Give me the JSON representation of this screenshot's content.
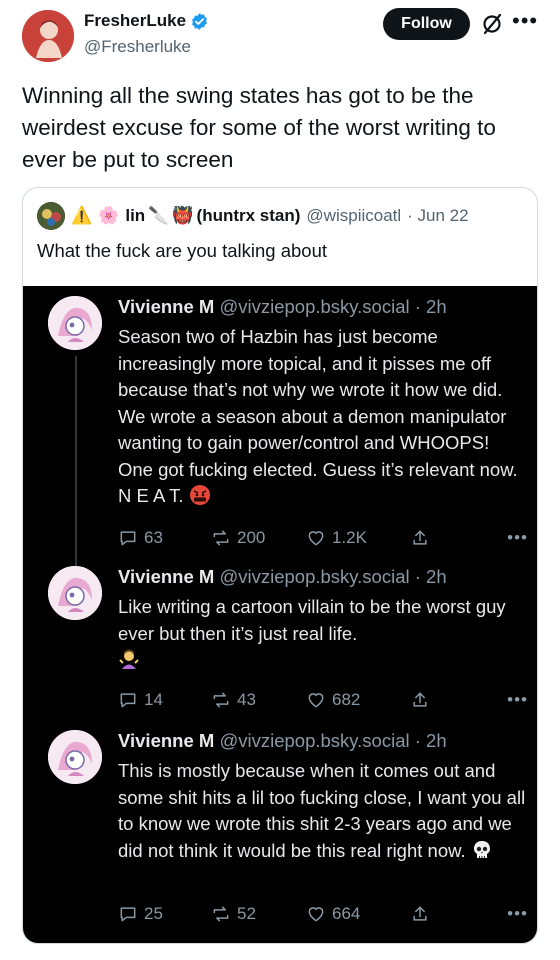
{
  "author": {
    "display_name": "FresherLuke",
    "handle": "@Fresherluke",
    "follow_label": "Follow"
  },
  "tweet": {
    "text": "Winning all the swing states has got to be the weirdest excuse for some of the worst writing to ever be put to screen"
  },
  "quoted": {
    "name": "lin",
    "name_suffix": "(huntrx stan)",
    "handle": "@wispiicoatl",
    "time": "· Jun 22",
    "text": "What the fuck are you talking about"
  },
  "screenshot_posts": [
    {
      "name": "Vivienne M",
      "handle": "@vivziepop.bsky.social · 2h",
      "body": "Season two of Hazbin has just become increasingly more topical, and it pisses me off because that’s not why we wrote it how we did. We wrote a season about a demon manipulator wanting to gain power/control and WHOOPS! One got fucking elected. Guess it’s relevant now. N E A T.",
      "emoji": "angry-face-emoji",
      "replies": "63",
      "reposts": "200",
      "likes": "1.2K"
    },
    {
      "name": "Vivienne M",
      "handle": "@vivziepop.bsky.social · 2h",
      "body": "Like writing a cartoon villain to be the worst guy ever but then it’s just real life.",
      "emoji": "shrug-emoji",
      "replies": "14",
      "reposts": "43",
      "likes": "682"
    },
    {
      "name": "Vivienne M",
      "handle": "@vivziepop.bsky.social · 2h",
      "body": "This is mostly because when it comes out and some shit hits a lil too fucking close, I want you all to know we wrote this shit 2-3 years ago and we did not think it would be this real right now.",
      "emoji": "skull-emoji",
      "replies": "25",
      "reposts": "52",
      "likes": "664"
    }
  ],
  "colors": {
    "verified": "#1d9bf0",
    "follow_bg": "#0f1419",
    "dark_bg": "#000000",
    "dark_text": "#e7e9ea",
    "muted": "#8b98a5"
  }
}
